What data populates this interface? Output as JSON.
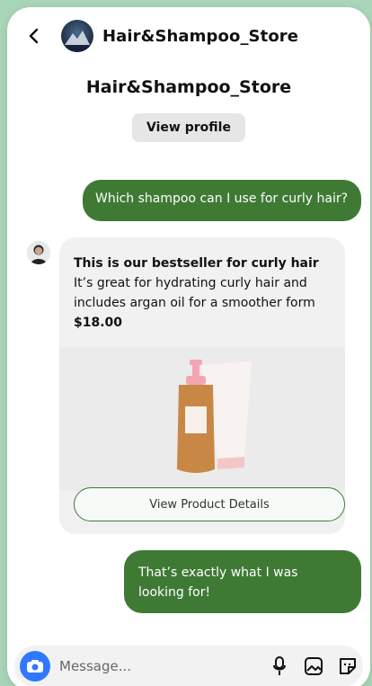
{
  "header": {
    "back_icon": "chevron-left-icon",
    "store_name": "Hair&Shampoo_Store"
  },
  "profile": {
    "name": "Hair&Shampoo_Store",
    "view_profile_label": "View profile"
  },
  "messages": [
    {
      "from": "user",
      "text": "Which shampoo can I use for curly hair?"
    },
    {
      "from": "store",
      "title": "This is our bestseller for curly hair",
      "body": "It’s great for hydrating curly hair and includes argan oil for a smoother form",
      "price": "$18.00",
      "button_label": "View Product Details"
    },
    {
      "from": "user",
      "text": "That’s exactly what I was looking for!"
    }
  ],
  "composer": {
    "placeholder": "Message...",
    "icons": [
      "camera-icon",
      "microphone-icon",
      "image-icon",
      "sticker-icon"
    ]
  },
  "colors": {
    "accent_green": "#3f7a35",
    "camera_blue": "#2f78ff",
    "background": "#a9d6b9"
  }
}
